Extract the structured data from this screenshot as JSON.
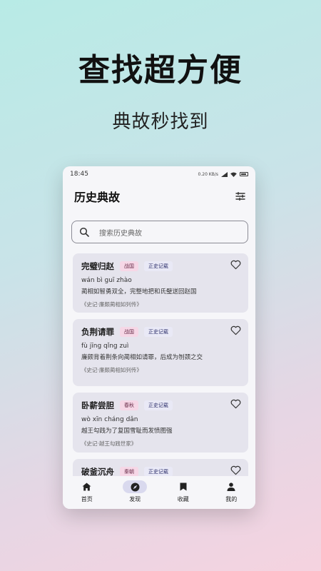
{
  "promo": {
    "headline": "查找超方便",
    "subline": "典故秒找到"
  },
  "status": {
    "time": "18:45",
    "network": "0.20 KB/s",
    "battery": "4G"
  },
  "app": {
    "title": "历史典故"
  },
  "search": {
    "placeholder": "搜索历史典故"
  },
  "cards": [
    {
      "title": "完璧归赵",
      "era": "战国",
      "source_tag": "正史记载",
      "pinyin": "wán bì guī zhào",
      "meaning": "蔺相如智勇双全，完整地把和氏璧送回赵国",
      "source": "《史记·廉颇蔺相如列传》"
    },
    {
      "title": "负荆请罪",
      "era": "战国",
      "source_tag": "正史记载",
      "pinyin": "fù jīng qǐng zuì",
      "meaning": "廉颇背着荆条向蔺相如请罪，后成为刎颈之交",
      "source": "《史记·廉颇蔺相如列传》"
    },
    {
      "title": "卧薪尝胆",
      "era": "春秋",
      "source_tag": "正史记载",
      "pinyin": "wò xīn cháng dǎn",
      "meaning": "越王勾践为了复国雪耻而发愤图强",
      "source": "《史记·越王勾践世家》"
    },
    {
      "title": "破釜沉舟",
      "era": "秦朝",
      "source_tag": "正史记载",
      "pinyin": "",
      "meaning": "",
      "source": ""
    }
  ],
  "nav": [
    {
      "label": "首页",
      "icon": "home-icon"
    },
    {
      "label": "发现",
      "icon": "compass-icon",
      "active": true
    },
    {
      "label": "收藏",
      "icon": "bookmark-icon"
    },
    {
      "label": "我的",
      "icon": "person-icon"
    }
  ]
}
